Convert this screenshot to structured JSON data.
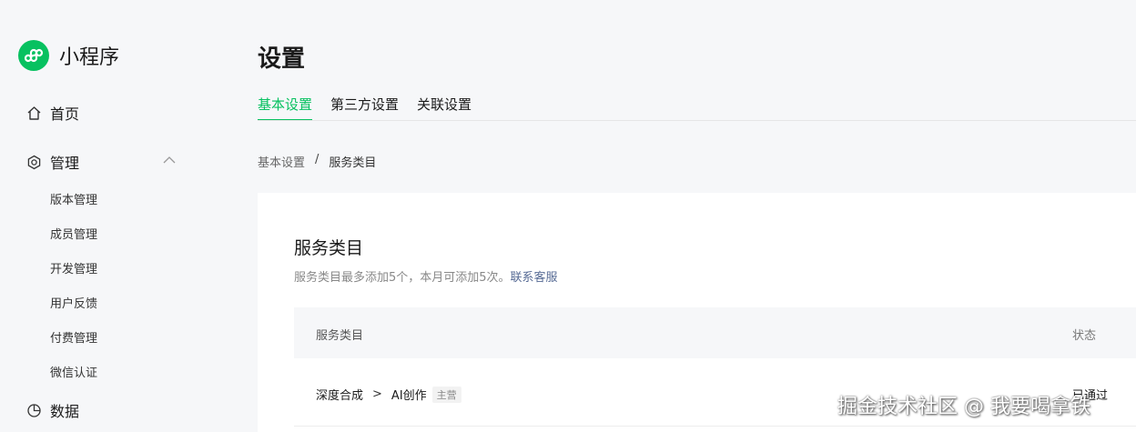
{
  "sidebar": {
    "brand": "小程序",
    "nav": {
      "home": "首页",
      "manage": "管理",
      "data": "数据"
    },
    "sub_items": [
      "版本管理",
      "成员管理",
      "开发管理",
      "用户反馈",
      "付费管理",
      "微信认证"
    ]
  },
  "page": {
    "title": "设置",
    "tabs": [
      "基本设置",
      "第三方设置",
      "关联设置"
    ]
  },
  "breadcrumb": {
    "parent": "基本设置",
    "separator": "/",
    "current": "服务类目"
  },
  "card": {
    "title": "服务类目",
    "desc": "服务类目最多添加5个，本月可添加5次。",
    "desc_link": "联系客服",
    "table": {
      "headers": [
        "服务类目",
        "状态"
      ],
      "rows": [
        {
          "cat_primary": "深度合成",
          "arrow": ">",
          "cat_secondary": "AI创作",
          "badge": "主营",
          "status": "已通过"
        }
      ]
    }
  },
  "watermark": "掘金技术社区 @ 我要喝拿铁",
  "colors": {
    "accent": "#07c160",
    "link": "#576b95"
  },
  "icons": [
    "miniprogram-logo-icon",
    "home-icon",
    "gear-icon",
    "chevron-up-icon",
    "chart-icon"
  ]
}
